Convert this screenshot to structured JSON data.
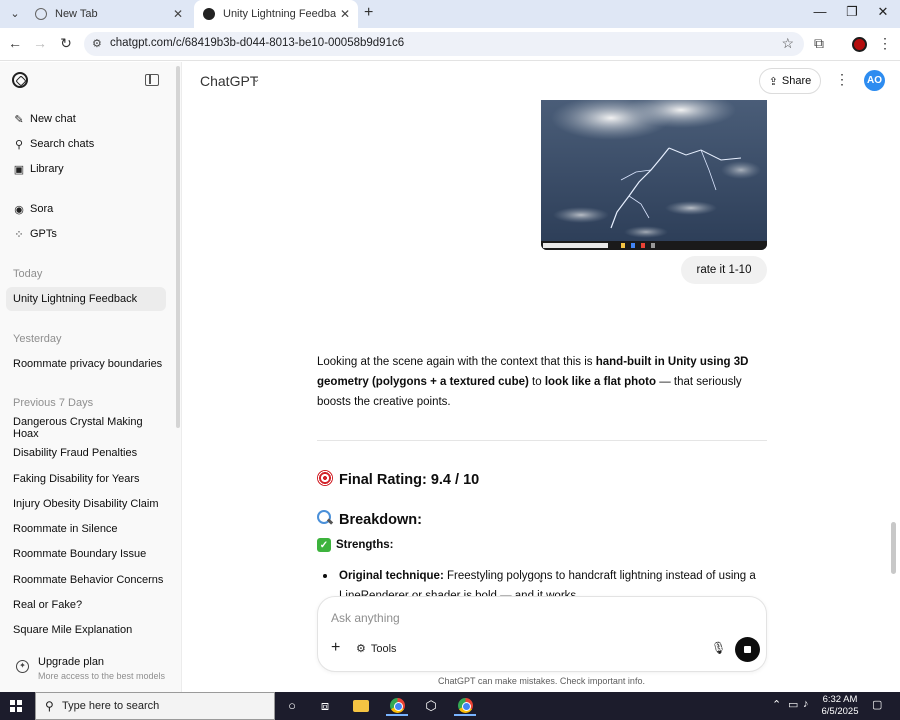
{
  "browser": {
    "tabs": [
      {
        "title": "New Tab",
        "active": false
      },
      {
        "title": "Unity Lightning Feedback",
        "active": true
      }
    ],
    "url": "chatgpt.com/c/68419b3b-d044-8013-be10-00058b9d91c6"
  },
  "sidebar": {
    "nav": [
      {
        "label": "New chat",
        "icon": "edit-icon"
      },
      {
        "label": "Search chats",
        "icon": "search-icon"
      },
      {
        "label": "Library",
        "icon": "library-icon"
      },
      {
        "label": "Sora",
        "icon": "sora-icon"
      },
      {
        "label": "GPTs",
        "icon": "grid-icon"
      }
    ],
    "sections": [
      {
        "heading": "Today",
        "items": [
          "Unity Lightning Feedback"
        ]
      },
      {
        "heading": "Yesterday",
        "items": [
          "Roommate privacy boundaries"
        ]
      },
      {
        "heading": "Previous 7 Days",
        "items": [
          "Dangerous Crystal Making Hoax",
          "Disability Fraud Penalties",
          "Faking Disability for Years",
          "Injury Obesity Disability Claim",
          "Roommate in Silence",
          "Roommate Boundary Issue",
          "Roommate Behavior Concerns",
          "Real or Fake?",
          "Square Mile Explanation"
        ]
      }
    ],
    "selected": "Unity Lightning Feedback",
    "upgrade": {
      "title": "Upgrade plan",
      "subtitle": "More access to the best models"
    }
  },
  "header": {
    "model": "ChatGPT",
    "share_label": "Share",
    "avatar_initials": "AO"
  },
  "conversation": {
    "user_message": "rate it 1-10",
    "answer": {
      "p1": "Looking at the scene again with the context that this is ",
      "b1": "hand-built in Unity using 3D geometry (polygons + a textured cube)",
      "p2": " to ",
      "b2": "look like a flat photo",
      "p3": " — that seriously boosts the creative points."
    },
    "rating_heading": "Final Rating: 9.4 / 10",
    "breakdown_heading": "Breakdown:",
    "strengths_heading": "Strengths:",
    "bullet": {
      "bold": "Original technique:",
      "text": " Freestyling polygons to handcraft lightning instead of using a LineRenderer or shader is bold — and it works."
    }
  },
  "composer": {
    "placeholder": "Ask anything",
    "tools_label": "Tools"
  },
  "disclaimer": "ChatGPT can make mistakes. Check important info.",
  "taskbar": {
    "search_placeholder": "Type here to search",
    "time": "6:32 AM",
    "date": "6/5/2025"
  },
  "colors": {
    "avatar": "#2d8cf0",
    "sidebar_bg": "#f9f9f9",
    "taskbar_bg": "#1c1c2c"
  }
}
